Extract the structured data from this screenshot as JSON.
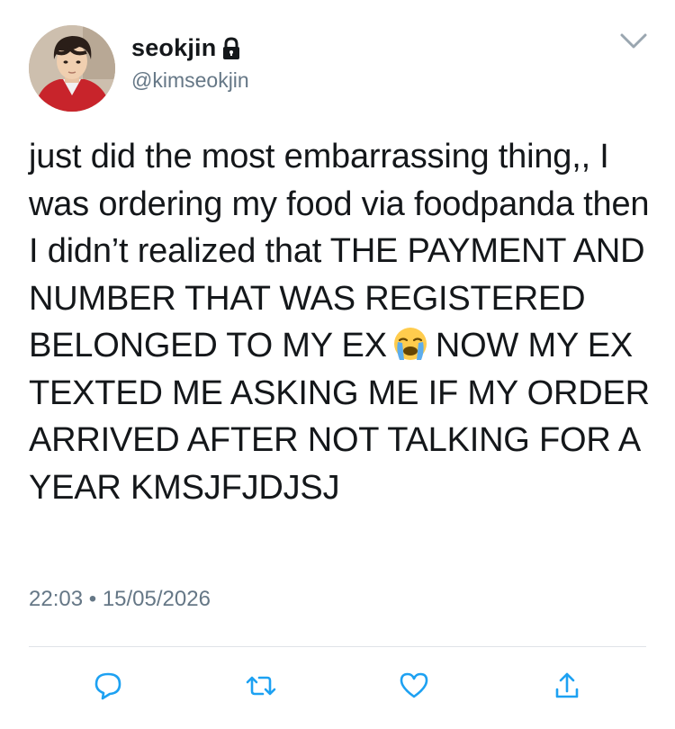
{
  "user": {
    "display_name": "seokjin",
    "handle": "@kimseokjin",
    "protected_icon": "lock-icon",
    "avatar": "profile-photo"
  },
  "tweet": {
    "text_before_emoji": "just did the most embarrassing thing,, I was ordering my food via foodpanda then I didn’t realized that THE PAYMENT AND NUMBER THAT WAS REGISTERED BELONGED TO MY EX",
    "emoji": "loudly-crying-face-emoji",
    "text_after_emoji": "NOW MY EX TEXTED ME ASKING ME IF MY ORDER ARRIVED AFTER NOT TALKING FOR A YEAR KMSJFJDJSJ",
    "time": "22:03",
    "separator": "•",
    "date": "15/05/2026"
  },
  "menu": {
    "icon": "chevron-down-icon"
  },
  "actions": [
    {
      "name": "reply",
      "icon": "comment-icon"
    },
    {
      "name": "retweet",
      "icon": "retweet-icon"
    },
    {
      "name": "like",
      "icon": "heart-icon"
    },
    {
      "name": "share",
      "icon": "share-icon"
    }
  ],
  "colors": {
    "text_primary": "#14171a",
    "text_secondary": "#657786",
    "accent_blue": "#1da1f2",
    "divider": "#dfe3e7"
  }
}
